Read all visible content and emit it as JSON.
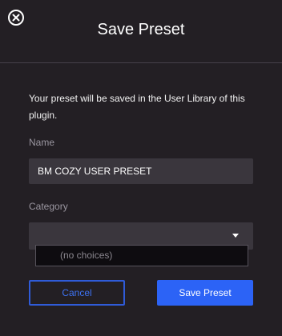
{
  "dialog": {
    "title": "Save Preset",
    "message": "Your preset will be saved in the User Library of this plugin.",
    "close_icon": "close-circle-x-icon"
  },
  "name_field": {
    "label": "Name",
    "value": "BM COZY USER PRESET"
  },
  "category_field": {
    "label": "Category",
    "selected": "",
    "options_text": "(no choices)",
    "arrow_icon": "caret-down-icon"
  },
  "buttons": {
    "cancel_label": "Cancel",
    "save_label": "Save Preset"
  },
  "colors": {
    "background": "#231f24",
    "field_background": "#3a363d",
    "accent_blue": "#2c63f6"
  }
}
